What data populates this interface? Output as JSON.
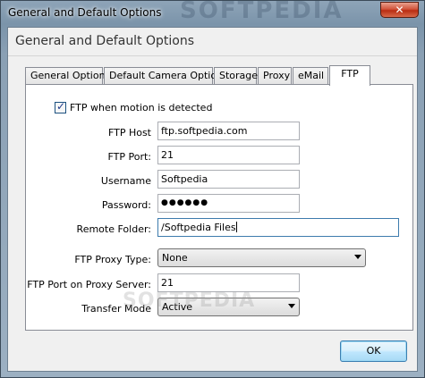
{
  "window": {
    "title": "General and Default Options",
    "watermark": "SOFTPEDIA",
    "close_glyph": "✕"
  },
  "dialog": {
    "header": "General and Default Options"
  },
  "tabs": [
    {
      "label": "General Options"
    },
    {
      "label": "Default Camera Options"
    },
    {
      "label": "Storage"
    },
    {
      "label": "Proxy"
    },
    {
      "label": "eMail"
    },
    {
      "label": "FTP",
      "active": true
    }
  ],
  "ftp": {
    "enable_label": "FTP when motion is detected",
    "enable_checked": true,
    "host_label": "FTP Host",
    "host_value": "ftp.softpedia.com",
    "port_label": "FTP Port:",
    "port_value": "21",
    "username_label": "Username",
    "username_value": "Softpedia",
    "password_label": "Password:",
    "password_value": "●●●●●●",
    "remote_folder_label": "Remote Folder:",
    "remote_folder_value": "/Softpedia Files",
    "proxy_type_label": "FTP Proxy Type:",
    "proxy_type_value": "None",
    "proxy_port_label": "FTP Port on Proxy Server:",
    "proxy_port_value": "21",
    "transfer_mode_label": "Transfer Mode",
    "transfer_mode_value": "Active"
  },
  "watermark_mid": "SOFTPEDIA",
  "buttons": {
    "ok": "OK"
  },
  "colors": {
    "titlebar": "#7b94aa",
    "close_button": "#c8432a",
    "ok_button_border": "#3c7fb1"
  }
}
